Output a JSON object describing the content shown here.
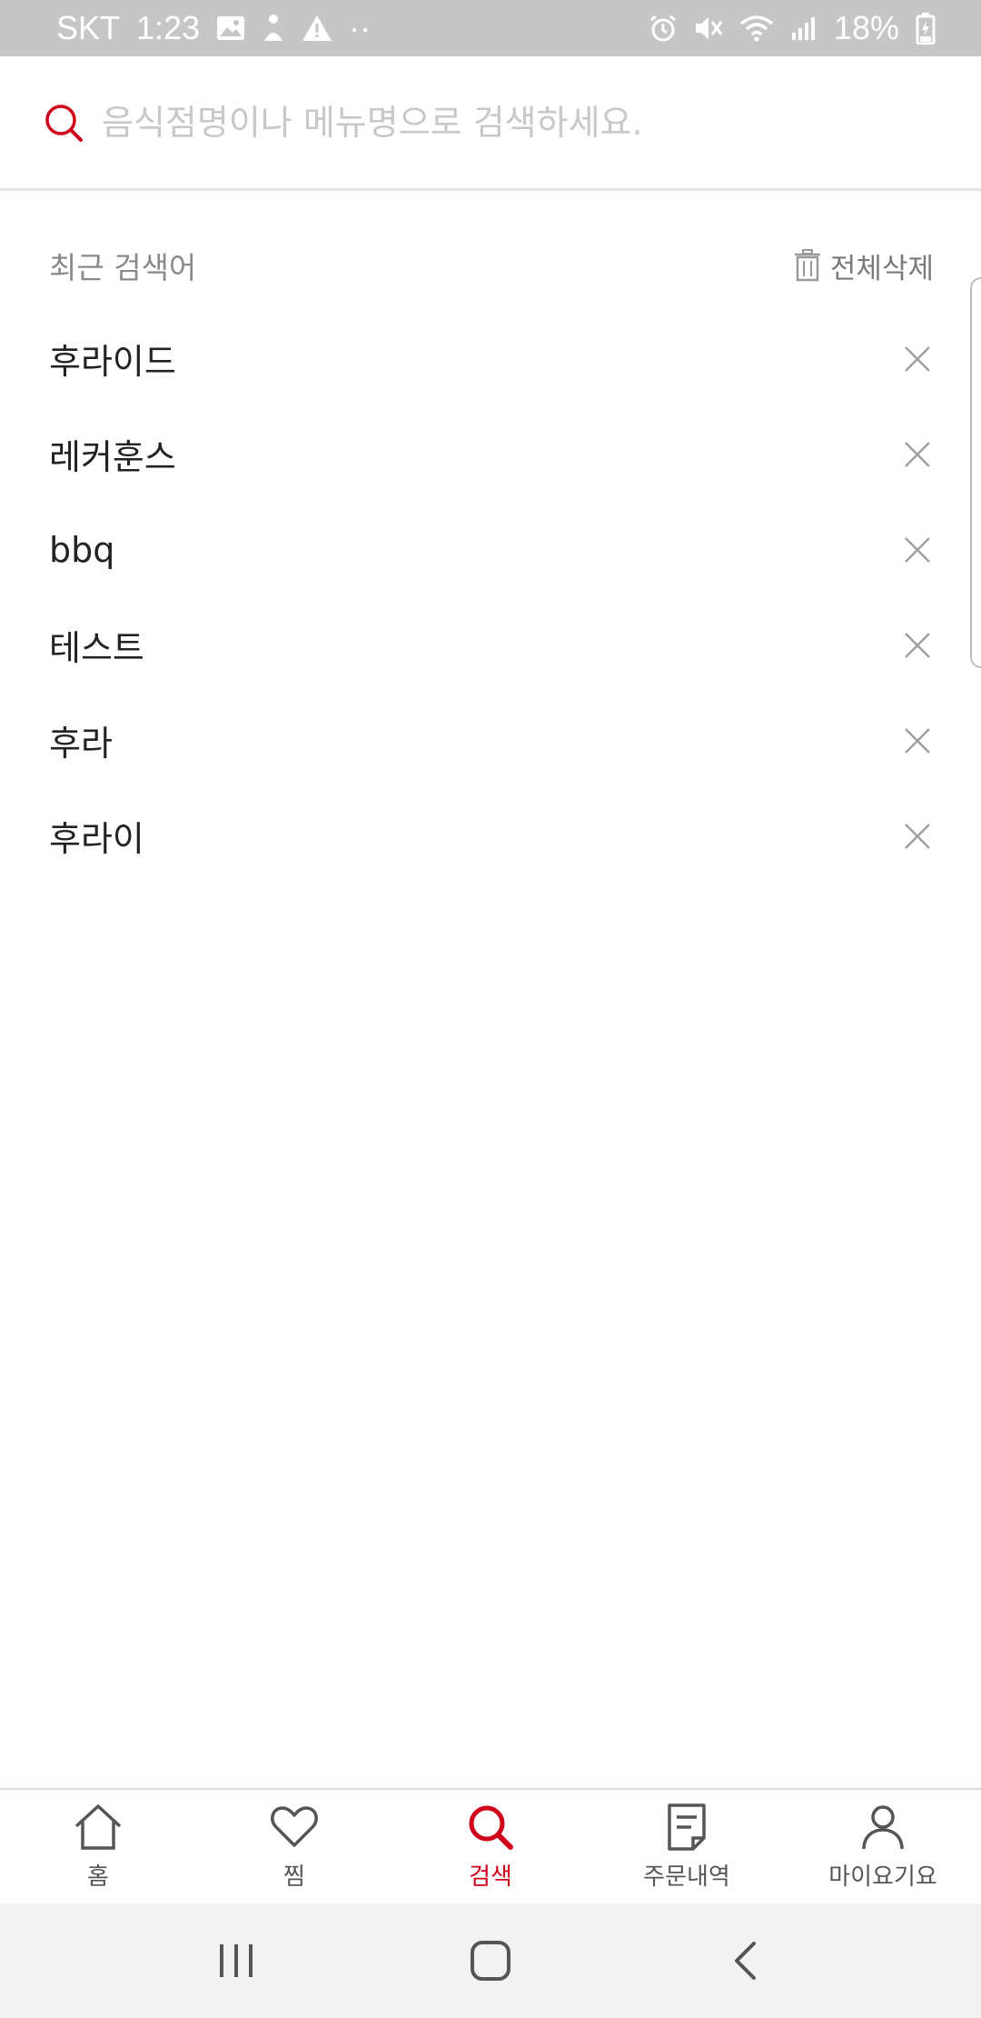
{
  "status_bar": {
    "carrier": "SKT",
    "time": "1:23",
    "dots": "··",
    "battery": "18%"
  },
  "search": {
    "placeholder": "음식점명이나 메뉴명으로 검색하세요."
  },
  "recent": {
    "title": "최근 검색어",
    "delete_all": "전체삭제",
    "items": [
      {
        "label": "후라이드"
      },
      {
        "label": "레커훈스"
      },
      {
        "label": "bbq"
      },
      {
        "label": "테스트"
      },
      {
        "label": "후라"
      },
      {
        "label": "후라이"
      }
    ]
  },
  "nav": {
    "items": [
      {
        "label": "홈",
        "icon": "home-icon"
      },
      {
        "label": "찜",
        "icon": "heart-icon"
      },
      {
        "label": "검색",
        "icon": "search-icon",
        "active": true
      },
      {
        "label": "주문내역",
        "icon": "document-icon"
      },
      {
        "label": "마이요기요",
        "icon": "person-icon"
      }
    ]
  },
  "colors": {
    "accent": "#d0021b",
    "status_bar": "#c6c6c6",
    "system_nav": "#f2f2f2"
  }
}
